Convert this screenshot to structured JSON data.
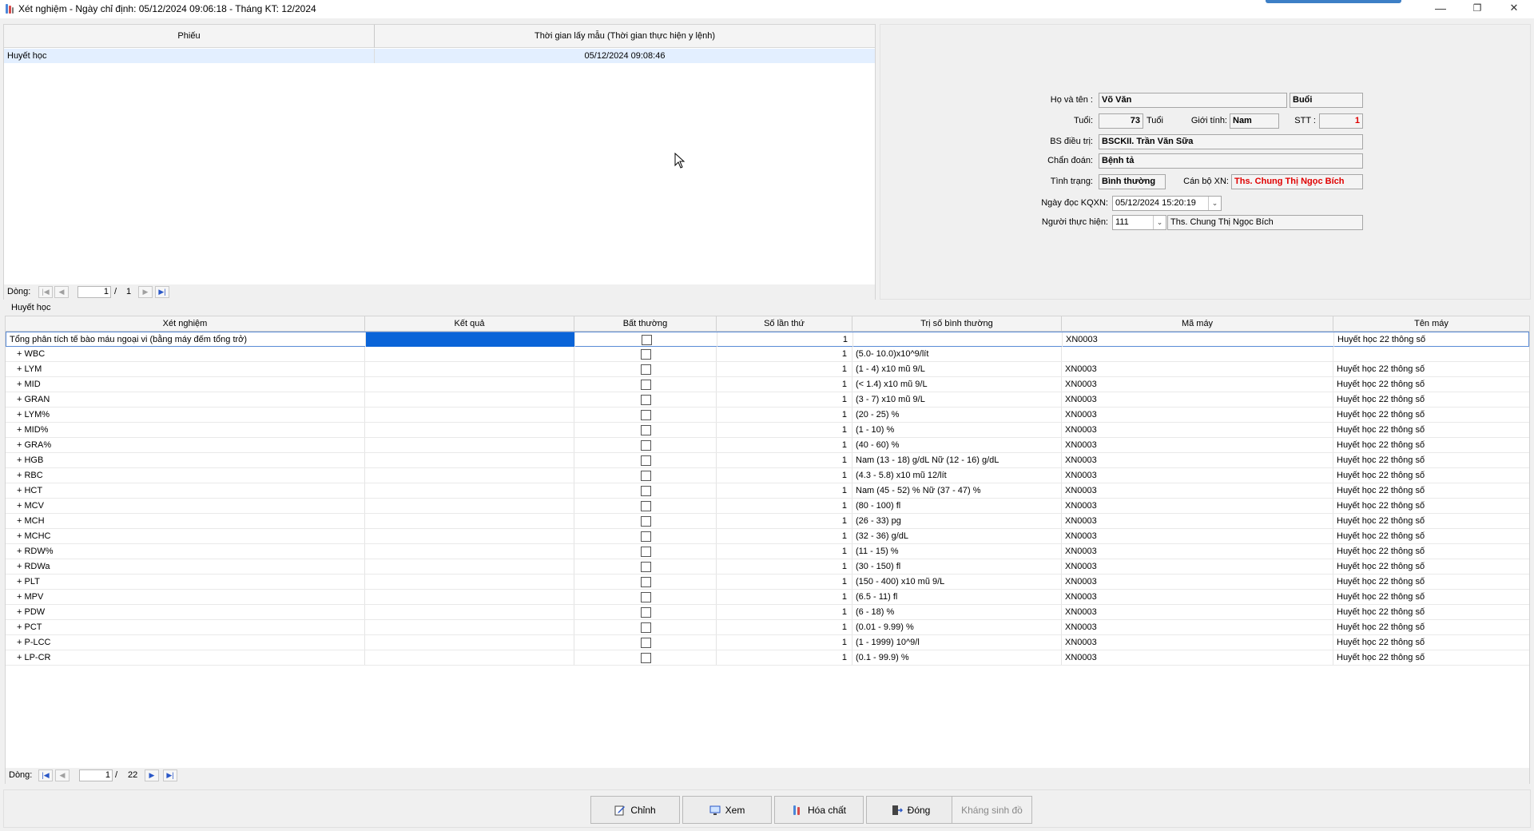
{
  "window": {
    "title": "Xét nghiệm - Ngày chỉ định: 05/12/2024 09:06:18 - Tháng KT: 12/2024",
    "minimize_glyph": "—",
    "restore_glyph": "❐",
    "close_glyph": "✕"
  },
  "phieu_table": {
    "headers": [
      "Phiếu",
      "Thời gian lấy mẫu (Thời gian thực hiện y lệnh)"
    ],
    "rows": [
      {
        "phieu": "Huyết học",
        "time": "05/12/2024 09:08:46"
      }
    ],
    "nav": {
      "label": "Dòng:",
      "current": "1",
      "separator": "/",
      "total": "1"
    }
  },
  "patient": {
    "name_label": "Họ và tên :",
    "name": "Võ Văn",
    "session": "Buổi",
    "age_label": "Tuổi:",
    "age": "73",
    "age_unit": "Tuổi",
    "gender_label": "Giới tính:",
    "gender": "Nam",
    "stt_label": "STT :",
    "stt": "1",
    "doctor_label": "BS điều trị:",
    "doctor": "BSCKII. Trần Văn Sữa",
    "diagnosis_label": "Chẩn đoán:",
    "diagnosis": "Bệnh tả",
    "status_label": "Tình trạng:",
    "status": "Bình thường",
    "staff_label": "Cán bộ XN:",
    "staff": "Ths. Chung Thị Ngọc Bích",
    "read_date_label": "Ngày đọc KQXN:",
    "read_date": "05/12/2024 15:20:19",
    "performer_label": "Người thực hiện:",
    "performer_code": "111",
    "performer_name": "Ths. Chung Thị Ngọc Bích"
  },
  "group_label": "Huyết học",
  "tests": {
    "headers": [
      "Xét nghiệm",
      "Kết quả",
      "Bất thường",
      "Số lần thứ",
      "Trị số bình thường",
      "Mã máy",
      "Tên máy"
    ],
    "rows": [
      {
        "name": "Tổng phân tích tế bào máu ngoại vi (bằng máy đếm tổng trở)",
        "result": "",
        "abnormal": false,
        "count": "1",
        "normal": "",
        "machine_code": "XN0003",
        "machine_name": "Huyết học 22 thông số"
      },
      {
        "name": "+ WBC",
        "result": "",
        "abnormal": false,
        "count": "1",
        "normal": "(5.0- 10.0)x10^9/lít",
        "machine_code": "",
        "machine_name": ""
      },
      {
        "name": "+ LYM",
        "result": "",
        "abnormal": false,
        "count": "1",
        "normal": "(1 - 4) x10 mũ 9/L",
        "machine_code": "XN0003",
        "machine_name": "Huyết học 22 thông số"
      },
      {
        "name": "+ MID",
        "result": "",
        "abnormal": false,
        "count": "1",
        "normal": "(< 1.4) x10 mũ 9/L",
        "machine_code": "XN0003",
        "machine_name": "Huyết học 22 thông số"
      },
      {
        "name": "+ GRAN",
        "result": "",
        "abnormal": false,
        "count": "1",
        "normal": "(3 - 7) x10 mũ 9/L",
        "machine_code": "XN0003",
        "machine_name": "Huyết học 22 thông số"
      },
      {
        "name": "+ LYM%",
        "result": "",
        "abnormal": false,
        "count": "1",
        "normal": "(20 - 25) %",
        "machine_code": "XN0003",
        "machine_name": "Huyết học 22 thông số"
      },
      {
        "name": "+ MID%",
        "result": "",
        "abnormal": false,
        "count": "1",
        "normal": "(1 - 10) %",
        "machine_code": "XN0003",
        "machine_name": "Huyết học 22 thông số"
      },
      {
        "name": "+ GRA%",
        "result": "",
        "abnormal": false,
        "count": "1",
        "normal": "(40 - 60) %",
        "machine_code": "XN0003",
        "machine_name": "Huyết học 22 thông số"
      },
      {
        "name": "+ HGB",
        "result": "",
        "abnormal": false,
        "count": "1",
        "normal": "Nam (13 - 18) g/dL  Nữ (12 - 16) g/dL",
        "machine_code": "XN0003",
        "machine_name": "Huyết học 22 thông số"
      },
      {
        "name": "+ RBC",
        "result": "",
        "abnormal": false,
        "count": "1",
        "normal": "(4.3 - 5.8) x10 mũ 12/lít",
        "machine_code": "XN0003",
        "machine_name": "Huyết học 22 thông số"
      },
      {
        "name": "+ HCT",
        "result": "",
        "abnormal": false,
        "count": "1",
        "normal": "Nam (45 - 52) %  Nữ (37 - 47) %",
        "machine_code": "XN0003",
        "machine_name": "Huyết học 22 thông số"
      },
      {
        "name": "+ MCV",
        "result": "",
        "abnormal": false,
        "count": "1",
        "normal": "(80 - 100) fl",
        "machine_code": "XN0003",
        "machine_name": "Huyết học 22 thông số"
      },
      {
        "name": "+ MCH",
        "result": "",
        "abnormal": false,
        "count": "1",
        "normal": "(26 - 33) pg",
        "machine_code": "XN0003",
        "machine_name": "Huyết học 22 thông số"
      },
      {
        "name": "+ MCHC",
        "result": "",
        "abnormal": false,
        "count": "1",
        "normal": "(32 - 36) g/dL",
        "machine_code": "XN0003",
        "machine_name": "Huyết học 22 thông số"
      },
      {
        "name": "+ RDW%",
        "result": "",
        "abnormal": false,
        "count": "1",
        "normal": "(11 - 15) %",
        "machine_code": "XN0003",
        "machine_name": "Huyết học 22 thông số"
      },
      {
        "name": "+ RDWa",
        "result": "",
        "abnormal": false,
        "count": "1",
        "normal": "(30 - 150) fl",
        "machine_code": "XN0003",
        "machine_name": "Huyết học 22 thông số"
      },
      {
        "name": "+ PLT",
        "result": "",
        "abnormal": false,
        "count": "1",
        "normal": "(150 - 400) x10 mũ 9/L",
        "machine_code": "XN0003",
        "machine_name": "Huyết học 22 thông số"
      },
      {
        "name": "+ MPV",
        "result": "",
        "abnormal": false,
        "count": "1",
        "normal": "(6.5 - 11) fl",
        "machine_code": "XN0003",
        "machine_name": "Huyết học 22 thông số"
      },
      {
        "name": "+ PDW",
        "result": "",
        "abnormal": false,
        "count": "1",
        "normal": "(6 - 18) %",
        "machine_code": "XN0003",
        "machine_name": "Huyết học 22 thông số"
      },
      {
        "name": "+ PCT",
        "result": "",
        "abnormal": false,
        "count": "1",
        "normal": "(0.01 - 9.99) %",
        "machine_code": "XN0003",
        "machine_name": "Huyết học 22 thông số"
      },
      {
        "name": "+ P-LCC",
        "result": "",
        "abnormal": false,
        "count": "1",
        "normal": "(1 - 1999) 10^9/l",
        "machine_code": "XN0003",
        "machine_name": "Huyết học 22 thông số"
      },
      {
        "name": "+ LP-CR",
        "result": "",
        "abnormal": false,
        "count": "1",
        "normal": "(0.1 - 99.9) %",
        "machine_code": "XN0003",
        "machine_name": "Huyết học 22 thông số"
      }
    ],
    "nav": {
      "label": "Dòng:",
      "current": "1",
      "separator": "/",
      "total": "22"
    }
  },
  "buttons": [
    {
      "name": "edit-button",
      "label": "Chỉnh",
      "icon": "edit-icon",
      "enabled": true
    },
    {
      "name": "view-button",
      "label": "Xem",
      "icon": "view-icon",
      "enabled": true
    },
    {
      "name": "chemical-button",
      "label": "Hóa chất",
      "icon": "chemical-icon",
      "enabled": true
    },
    {
      "name": "close-button",
      "label": "Đóng",
      "icon": "exit-icon",
      "enabled": true
    },
    {
      "name": "antibiogram-button",
      "label": "Kháng sinh đồ",
      "icon": "",
      "enabled": false
    }
  ],
  "colors": {
    "selection": "#0a64d8",
    "highlight_row": "#e3efff",
    "error_text": "#e00000",
    "nav_blue": "#2a57c7"
  }
}
